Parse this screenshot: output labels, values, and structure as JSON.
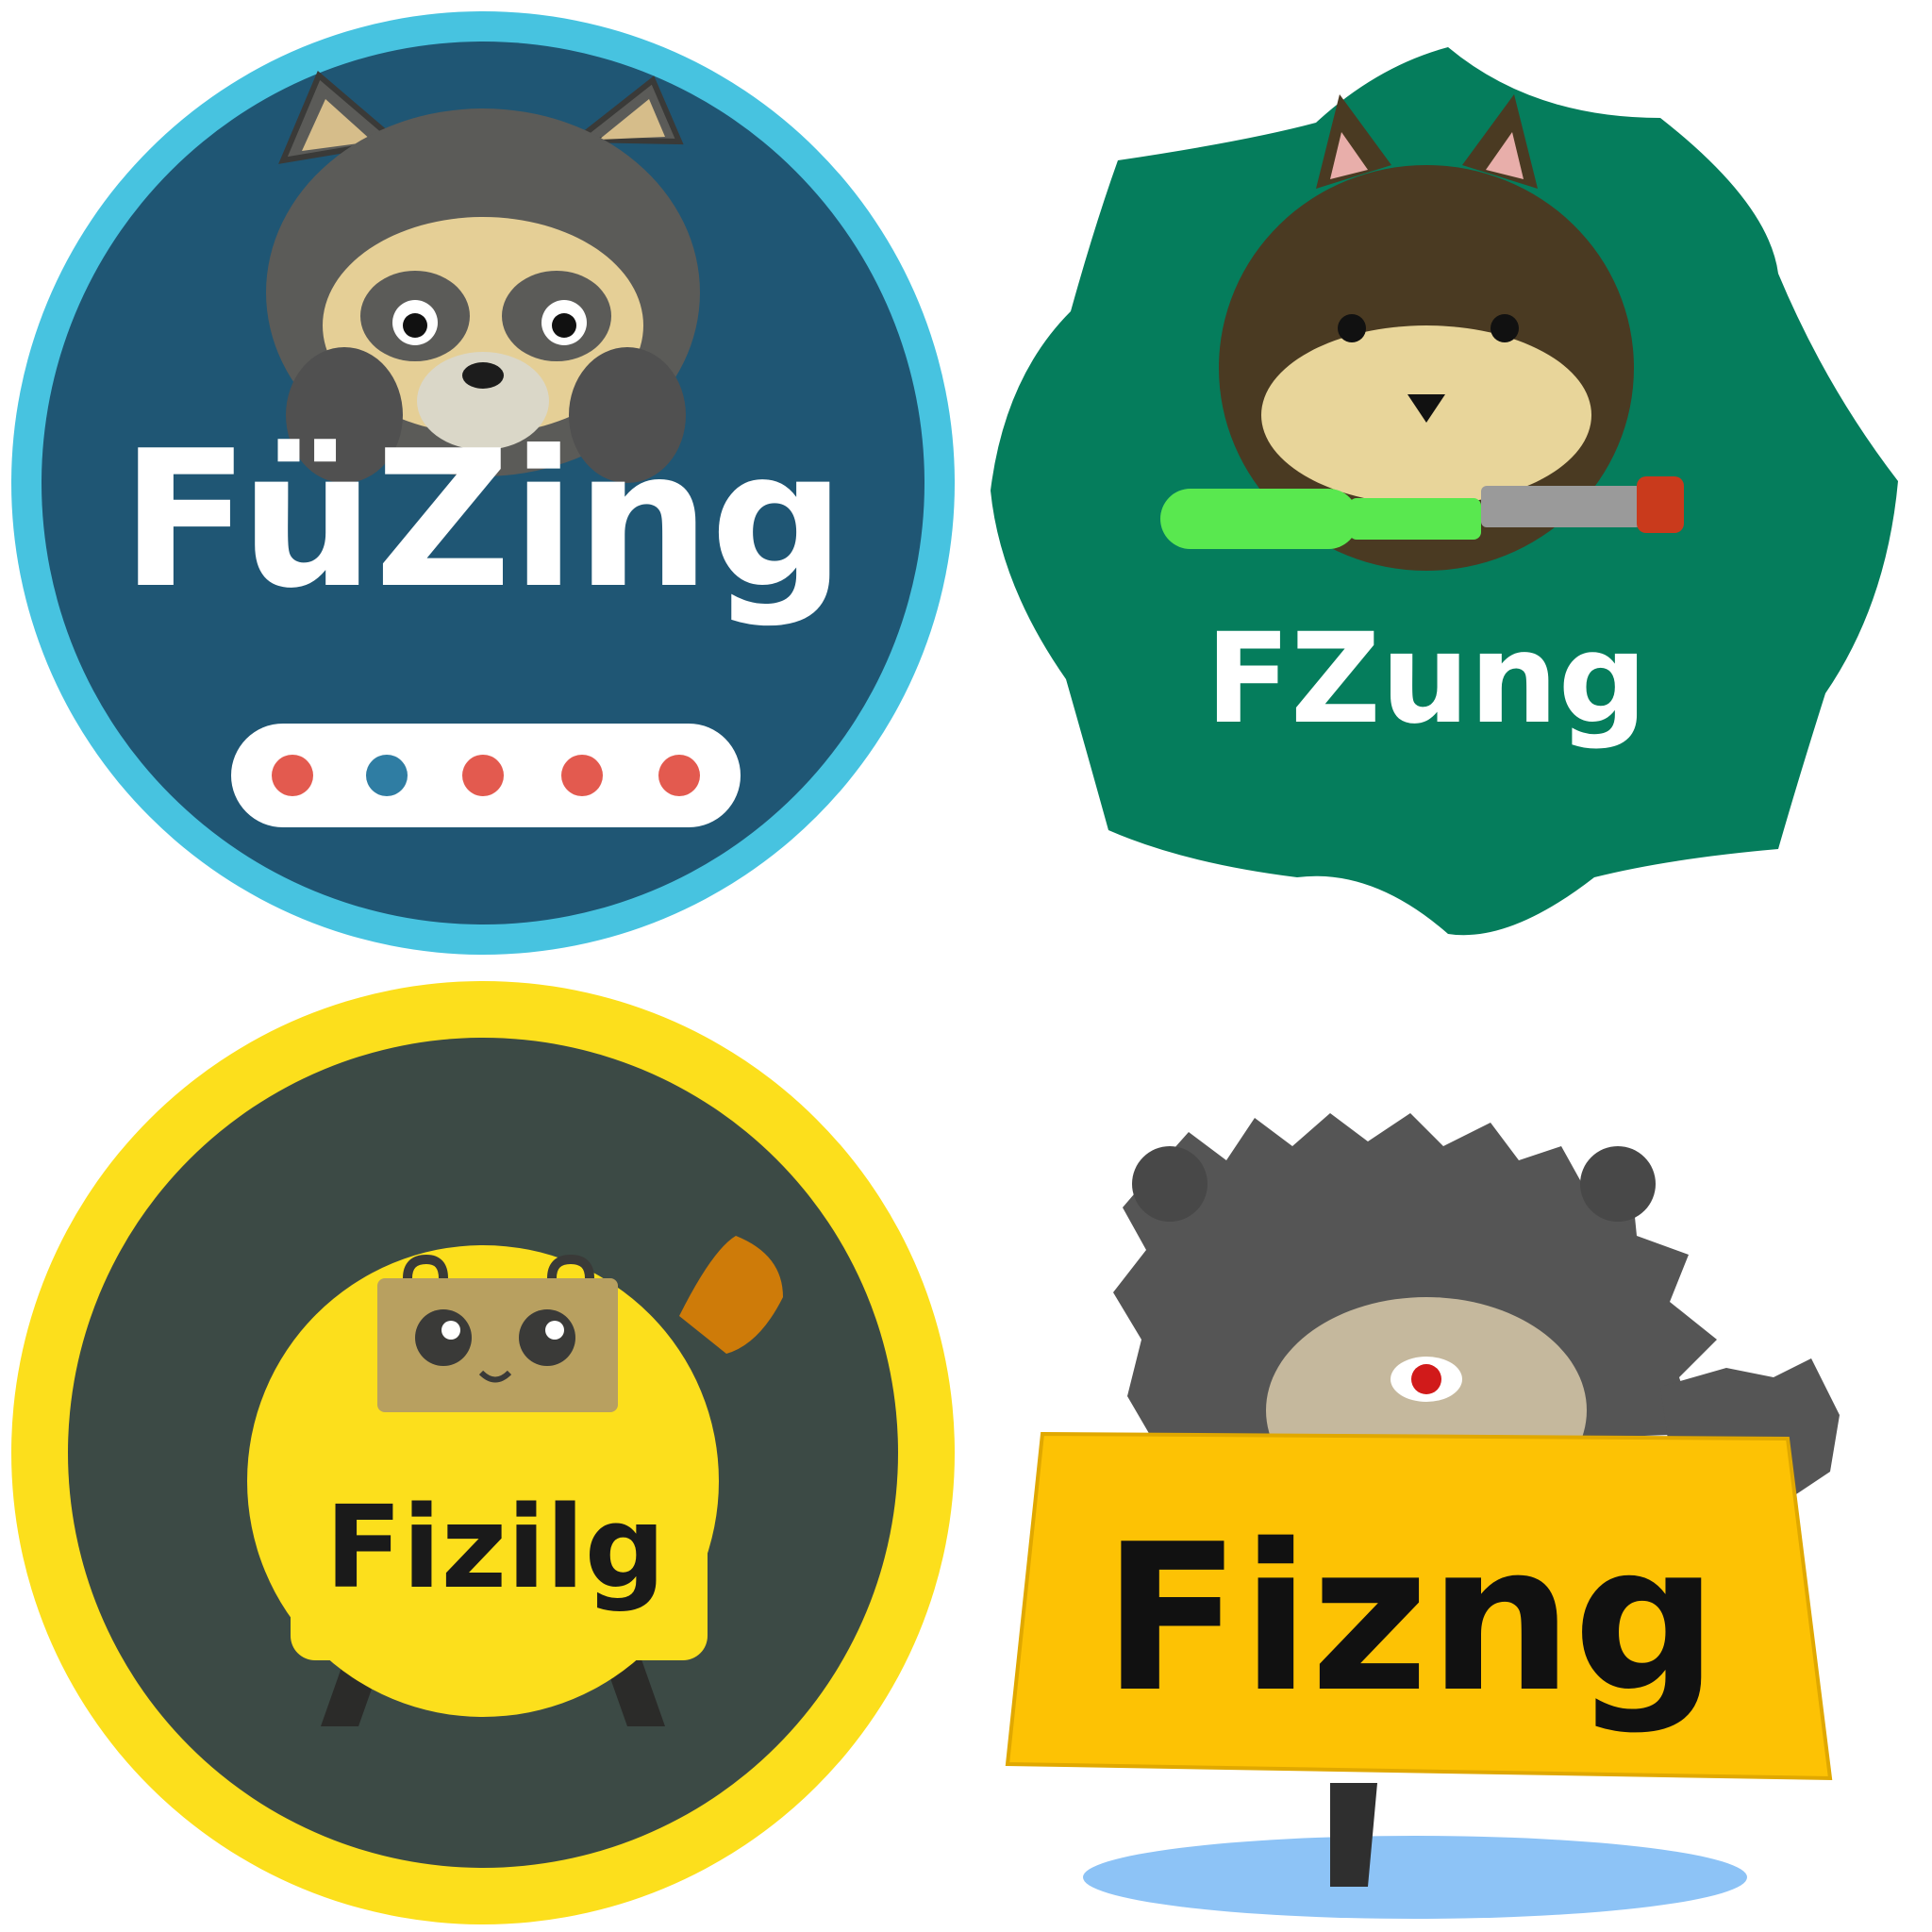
{
  "badges": [
    {
      "text": "FüZing",
      "style": "blue circle",
      "colors": {
        "ring": "#47c3e0",
        "fill": "#1f5674",
        "text": "#ffffff",
        "dot_red": "#e35a4f",
        "dot_blue": "#2f7da3"
      },
      "indicator_dots": [
        "red",
        "blue",
        "red",
        "red",
        "red"
      ]
    },
    {
      "text": "FZung",
      "style": "green scalloped badge",
      "colors": {
        "fill": "#057d5c",
        "text": "#ffffff",
        "tool": "#59e84f"
      }
    },
    {
      "text": "Fizilg",
      "style": "yellow circle",
      "colors": {
        "ring": "#fcdf1c",
        "fill": "#3c4a45",
        "text": "#1a1a1a"
      }
    },
    {
      "text": "Fizng",
      "style": "yellow sign",
      "colors": {
        "sign": "#fdc204",
        "text": "#111111",
        "shadow": "#8dc3f6"
      }
    }
  ]
}
